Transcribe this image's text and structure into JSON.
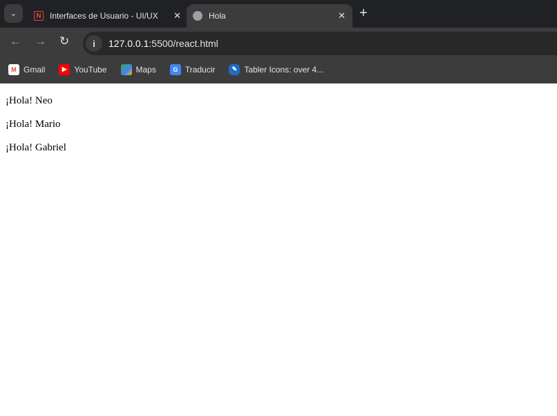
{
  "browser": {
    "tabs": [
      {
        "title": "Interfaces de Usuario - UI/UX",
        "icon": "notion-icon",
        "active": false
      },
      {
        "title": "Hola",
        "icon": "globe-icon",
        "active": true
      }
    ],
    "address": {
      "host": "127.0.0.1",
      "rest": ":5500/react.html"
    },
    "bookmarks": [
      {
        "label": "Gmail",
        "icon": "gmail-icon",
        "color": "#ea4335"
      },
      {
        "label": "YouTube",
        "icon": "youtube-icon",
        "color": "#ff0000"
      },
      {
        "label": "Maps",
        "icon": "maps-icon",
        "color": "#34a853"
      },
      {
        "label": "Traducir",
        "icon": "translate-icon",
        "color": "#4285f4"
      },
      {
        "label": "Tabler Icons: over 4...",
        "icon": "tabler-icon",
        "color": "#206bc4"
      }
    ]
  },
  "page": {
    "greetings": [
      "¡Hola! Neo",
      "¡Hola! Mario",
      "¡Hola! Gabriel"
    ]
  }
}
